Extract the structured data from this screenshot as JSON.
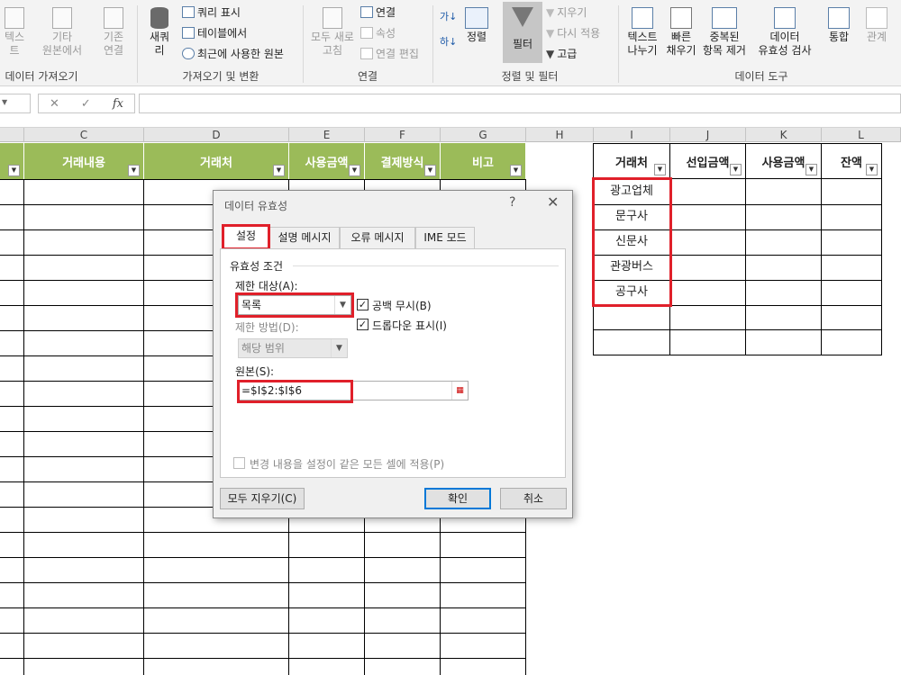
{
  "ribbon": {
    "get_text": "텍스트",
    "other_line1": "기타",
    "other_line2": "원본에서",
    "existing_line1": "기존",
    "existing_line2": "연결",
    "new_query_line1": "새쿼",
    "new_query_line2": "리",
    "show_query": "쿼리 표시",
    "from_table": "테이블에서",
    "recent_sources": "최근에 사용한 원본",
    "refresh_all_line1": "모두 새로",
    "refresh_all_line2": "고침",
    "connections": "연결",
    "properties": "속성",
    "edit_links": "연결 편집",
    "sort": "정렬",
    "filter": "필터",
    "clear": "지우기",
    "reapply": "다시 적용",
    "advanced": "고급",
    "text_to_columns_line1": "텍스트",
    "text_to_columns_line2": "나누기",
    "flash_fill_line1": "빠른",
    "flash_fill_line2": "채우기",
    "remove_dup_line1": "중복된",
    "remove_dup_line2": "항목 제거",
    "data_validation_line1": "데이터",
    "data_validation_line2": "유효성 검사",
    "consolidate": "통합",
    "relationships": "관계",
    "group_get_external": "데이터 가져오기",
    "group_get_transform": "가져오기 및 변환",
    "group_connections": "연결",
    "group_sort_filter": "정렬 및 필터",
    "group_data_tools": "데이터 도구"
  },
  "formula_bar": {
    "fx": "fx",
    "cancel": "✕",
    "enter": "✓"
  },
  "columns": [
    "C",
    "D",
    "E",
    "F",
    "G",
    "H",
    "I",
    "J",
    "K",
    "L"
  ],
  "left_table_headers": [
    "거래내용",
    "거래처",
    "사용금액",
    "결제방식",
    "비고"
  ],
  "right_table_headers": [
    "거래처",
    "선입금액",
    "사용금액",
    "잔액"
  ],
  "vendors": [
    "광고업체",
    "문구사",
    "신문사",
    "관광버스",
    "공구사"
  ],
  "dialog": {
    "title": "데이터 유효성",
    "help": "?",
    "close": "✕",
    "tabs": [
      "설정",
      "설명 메시지",
      "오류 메시지",
      "IME 모드"
    ],
    "section_title": "유효성 조건",
    "allow_label": "제한 대상(A):",
    "allow_value": "목록",
    "ignore_blank": "공백 무시(B)",
    "in_cell_dropdown": "드롭다운 표시(I)",
    "data_label": "제한 방법(D):",
    "data_value": "해당 범위",
    "source_label": "원본(S):",
    "source_value": "=$I$2:$I$6",
    "apply_all": "변경 내용을 설정이 같은 모든 셀에 적용(P)",
    "clear_all": "모두 지우기(C)",
    "ok": "확인",
    "cancel": "취소"
  },
  "colors": {
    "header_green": "#9bbb59",
    "highlight_red": "#e0202a",
    "accent_blue": "#0078d7"
  }
}
